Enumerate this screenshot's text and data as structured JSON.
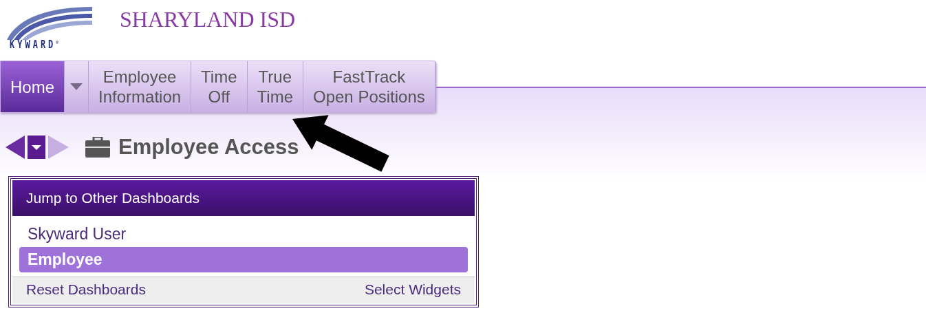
{
  "logo": {
    "text": "KYWARD",
    "mark": "®"
  },
  "district": "SHARYLAND ISD",
  "nav_tabs": [
    {
      "kind": "tab",
      "lines": [
        "Home"
      ],
      "selected": true
    },
    {
      "kind": "menu"
    },
    {
      "kind": "tab",
      "lines": [
        "Employee",
        "Information"
      ],
      "selected": false
    },
    {
      "kind": "tab",
      "lines": [
        "Time",
        "Off"
      ],
      "selected": false
    },
    {
      "kind": "tab",
      "lines": [
        "True",
        "Time"
      ],
      "selected": false
    },
    {
      "kind": "tab",
      "lines": [
        "FastTrack",
        "Open Positions"
      ],
      "selected": false
    }
  ],
  "page_title": "Employee Access",
  "forward_disabled": true,
  "widget": {
    "title": "Jump to Other Dashboards",
    "items": [
      {
        "label": "Skyward User",
        "selected": false
      },
      {
        "label": "Employee",
        "selected": true
      }
    ],
    "footer": [
      "Reset Dashboards",
      "Select Widgets"
    ]
  }
}
